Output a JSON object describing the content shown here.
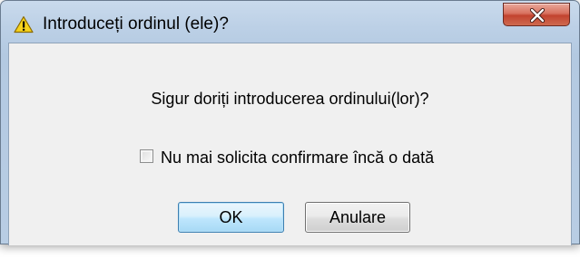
{
  "window": {
    "title": "Introduceți ordinul (ele)?",
    "title_icon": "warning-icon",
    "close_icon": "close-icon"
  },
  "dialog": {
    "message": "Sigur doriți introducerea ordinului(lor)?",
    "checkbox": {
      "label": "Nu mai solicita confirmare încă o dată",
      "checked": false
    },
    "buttons": {
      "ok_label": "OK",
      "cancel_label": "Anulare"
    }
  },
  "colors": {
    "frame": "#b8cde4",
    "client_background": "#f0f0f0",
    "close_button": "#c2432f",
    "default_button_border": "#3c7fb1"
  }
}
